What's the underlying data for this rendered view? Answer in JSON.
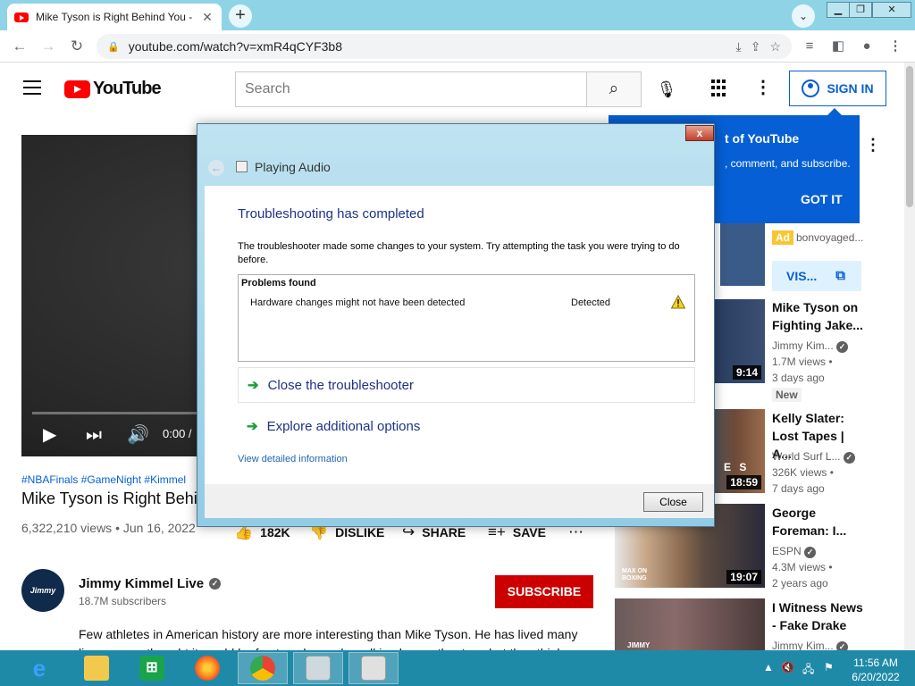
{
  "browser": {
    "tab_title": "Mike Tyson is Right Behind You -",
    "tab_close": "✕",
    "new_tab": "+",
    "url": "youtube.com/watch?v=xmR4qCYF3b8"
  },
  "header": {
    "logo_text": "YouTube",
    "search_placeholder": "Search",
    "sign_in_label": "SIGN IN"
  },
  "video": {
    "time_display": "0:00 /",
    "hashtags": "#NBAFinals #GameNight #Kimmel",
    "title": "Mike Tyson is Right Behind You",
    "stats": "6,322,210 views • Jun 16, 2022",
    "likes": "182K",
    "dislike_label": "DISLIKE",
    "share_label": "SHARE",
    "save_label": "SAVE"
  },
  "channel": {
    "avatar_text": "Jimmy Kimmel",
    "name": "Jimmy Kimmel Live",
    "subscribers": "18.7M subscribers",
    "subscribe_label": "SUBSCRIBE",
    "description": "Few athletes in American history are more interesting than Mike Tyson. He has lived many lives, so we thought it would be fun to ask people walking by our theater what they think"
  },
  "tooltip": {
    "title": "t of YouTube",
    "text": ", comment, and subscribe.",
    "button": "GOT IT"
  },
  "ad": {
    "badge": "Ad",
    "source": "bonvoyaged...",
    "visit_label": "VIS..."
  },
  "recommendations": [
    {
      "title": "Mike Tyson on Fighting Jake...",
      "channel": "Jimmy Kim...",
      "views": "1.7M views •",
      "age": "3 days ago",
      "duration": "9:14",
      "badge": "New"
    },
    {
      "title": "Kelly Slater: Lost Tapes | A...",
      "channel": "World Surf L...",
      "views": "326K views •",
      "age": "7 days ago",
      "duration": "18:59",
      "thumb_text": "E S"
    },
    {
      "title": "George Foreman: I...",
      "channel": "ESPN",
      "views": "4.3M views •",
      "age": "2 years ago",
      "duration": "19:07",
      "thumb_text": "MAX ON BOXING"
    },
    {
      "title": "I Witness News - Fake Drake",
      "channel": "Jimmy Kim...",
      "thumb_text": "JIMMY"
    }
  ],
  "dialog": {
    "close_x": "x",
    "back_glyph": "←",
    "title": "Playing Audio",
    "heading": "Troubleshooting has completed",
    "text": "The troubleshooter made some changes to your system. Try attempting the task you were trying to do before.",
    "problems_header": "Problems found",
    "problem_name": "Hardware changes might not have been detected",
    "problem_status": "Detected",
    "option_close": "Close the troubleshooter",
    "option_explore": "Explore additional options",
    "detail_link": "View detailed information",
    "close_button": "Close"
  },
  "taskbar": {
    "time": "11:56 AM",
    "date": "6/20/2022"
  },
  "colors": {
    "youtube_red": "#ff0000",
    "link_blue": "#065fd4",
    "subscribe_red": "#cc0000",
    "dialog_heading": "#1e3287",
    "taskbar": "#1f8aa7"
  }
}
